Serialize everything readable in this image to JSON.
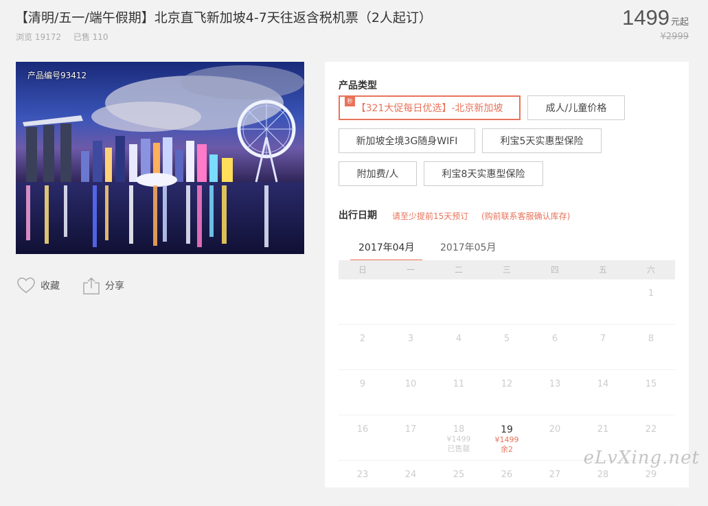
{
  "product": {
    "title": "【清明/五一/端午假期】北京直飞新加坡4-7天往返含税机票（2人起订）",
    "views": "浏览 19172",
    "sold": "已售 110",
    "price": "1499",
    "price_unit": "元起",
    "original_price": "¥2999",
    "product_no": "产品编号93412"
  },
  "actions": {
    "favorite": "收藏",
    "share": "分享"
  },
  "product_type": {
    "label": "产品类型",
    "badge": "秒",
    "options": [
      "【321大促每日优选】-北京新加坡",
      "成人/儿童价格",
      "新加坡全境3G随身WIFI",
      "利宝5天实惠型保险",
      "附加费/人",
      "利宝8天实惠型保险"
    ]
  },
  "travel_date": {
    "label": "出行日期",
    "hint1": "请至少提前15天预订",
    "hint2": "(购前联系客服确认库存)"
  },
  "months": [
    "2017年04月",
    "2017年05月"
  ],
  "weekdays": [
    "日",
    "一",
    "二",
    "三",
    "四",
    "五",
    "六"
  ],
  "calendar": {
    "rows": [
      [
        "",
        "",
        "",
        "",
        "",
        "",
        "1"
      ],
      [
        "2",
        "3",
        "4",
        "5",
        "6",
        "7",
        "8"
      ],
      [
        "9",
        "10",
        "11",
        "12",
        "13",
        "14",
        "15"
      ],
      [
        "16",
        "17",
        "18",
        "19",
        "20",
        "21",
        "22"
      ],
      [
        "23",
        "24",
        "25",
        "26",
        "27",
        "28",
        "29"
      ]
    ],
    "day18_price": "¥1499",
    "day18_status": "已售罄",
    "day19_price": "¥1499",
    "day19_status": "余2"
  },
  "watermark": "eLvXing.net",
  "colors": {
    "accent": "#e8735a",
    "background": "#f2f2f2"
  }
}
